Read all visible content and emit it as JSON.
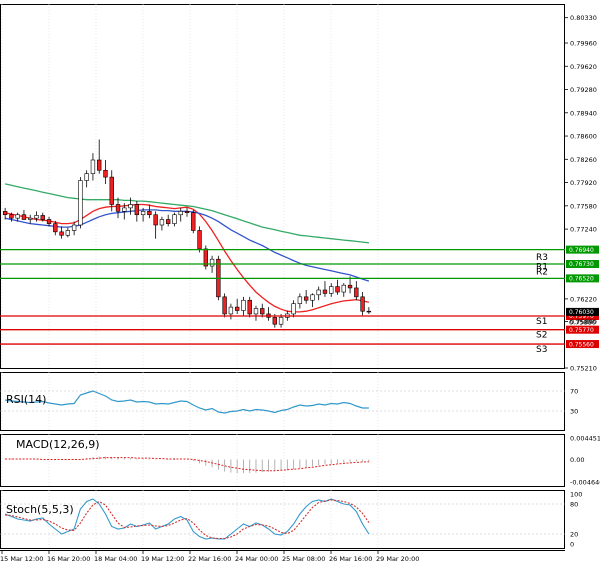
{
  "chart_data": [
    {
      "type": "candlestick",
      "title": "",
      "ylim": [
        0.7521,
        0.8053
      ],
      "y_ticks": [
        "0.80330",
        "0.79960",
        "0.79620",
        "0.79280",
        "0.78940",
        "0.78600",
        "0.78260",
        "0.77920",
        "0.77580",
        "0.77240",
        "0.76220",
        "0.75890",
        "0.75210"
      ],
      "x_ticks": [
        "15 Mar 12:00",
        "16 Mar 20:00",
        "18 Mar 04:00",
        "19 Mar 12:00",
        "22 Mar 16:00",
        "24 Mar 00:00",
        "25 Mar 08:00",
        "26 Mar 16:00",
        "29 Mar 20:00"
      ],
      "candles": [
        [
          0.775,
          0.7755,
          0.7738,
          0.7745
        ],
        [
          0.7745,
          0.7748,
          0.7735,
          0.774
        ],
        [
          0.774,
          0.7748,
          0.7735,
          0.7745
        ],
        [
          0.7745,
          0.7752,
          0.774,
          0.7738
        ],
        [
          0.7738,
          0.7745,
          0.7732,
          0.774
        ],
        [
          0.774,
          0.775,
          0.7735,
          0.7744
        ],
        [
          0.7744,
          0.7748,
          0.7735,
          0.7738
        ],
        [
          0.7738,
          0.7742,
          0.7728,
          0.7732
        ],
        [
          0.7732,
          0.7736,
          0.7715,
          0.772
        ],
        [
          0.772,
          0.7728,
          0.771,
          0.7715
        ],
        [
          0.7715,
          0.7726,
          0.7712,
          0.7722
        ],
        [
          0.7722,
          0.7735,
          0.7715,
          0.773
        ],
        [
          0.773,
          0.78,
          0.7725,
          0.7795
        ],
        [
          0.7795,
          0.781,
          0.7785,
          0.7805
        ],
        [
          0.7805,
          0.7835,
          0.7795,
          0.7825
        ],
        [
          0.7825,
          0.7855,
          0.7805,
          0.781
        ],
        [
          0.781,
          0.7825,
          0.779,
          0.78
        ],
        [
          0.78,
          0.781,
          0.775,
          0.776
        ],
        [
          0.776,
          0.777,
          0.774,
          0.775
        ],
        [
          0.775,
          0.7762,
          0.7738,
          0.7755
        ],
        [
          0.7755,
          0.777,
          0.7745,
          0.776
        ],
        [
          0.776,
          0.7765,
          0.7735,
          0.7745
        ],
        [
          0.7745,
          0.7755,
          0.7735,
          0.775
        ],
        [
          0.775,
          0.776,
          0.774,
          0.7745
        ],
        [
          0.7745,
          0.775,
          0.771,
          0.773
        ],
        [
          0.773,
          0.7742,
          0.7722,
          0.7738
        ],
        [
          0.7738,
          0.7745,
          0.7728,
          0.7732
        ],
        [
          0.7732,
          0.7748,
          0.7728,
          0.7745
        ],
        [
          0.7745,
          0.7755,
          0.7735,
          0.775
        ],
        [
          0.775,
          0.7755,
          0.7742,
          0.7748
        ],
        [
          0.7748,
          0.7752,
          0.7718,
          0.7722
        ],
        [
          0.7722,
          0.7728,
          0.769,
          0.7695
        ],
        [
          0.7695,
          0.77,
          0.7665,
          0.767
        ],
        [
          0.767,
          0.7685,
          0.766,
          0.768
        ],
        [
          0.768,
          0.7685,
          0.762,
          0.7625
        ],
        [
          0.7625,
          0.763,
          0.7595,
          0.76
        ],
        [
          0.76,
          0.7615,
          0.7592,
          0.761
        ],
        [
          0.761,
          0.7622,
          0.76,
          0.7605
        ],
        [
          0.7605,
          0.7625,
          0.7598,
          0.762
        ],
        [
          0.762,
          0.7625,
          0.7595,
          0.76
        ],
        [
          0.76,
          0.7612,
          0.759,
          0.7608
        ],
        [
          0.7608,
          0.7615,
          0.7595,
          0.76
        ],
        [
          0.76,
          0.761,
          0.759,
          0.7595
        ],
        [
          0.7595,
          0.76,
          0.758,
          0.7585
        ],
        [
          0.7585,
          0.76,
          0.758,
          0.7595
        ],
        [
          0.7595,
          0.7605,
          0.759,
          0.76
        ],
        [
          0.76,
          0.762,
          0.7595,
          0.7615
        ],
        [
          0.7615,
          0.763,
          0.7608,
          0.7625
        ],
        [
          0.7625,
          0.7635,
          0.7615,
          0.762
        ],
        [
          0.762,
          0.763,
          0.761,
          0.7628
        ],
        [
          0.7628,
          0.764,
          0.762,
          0.7635
        ],
        [
          0.7635,
          0.7648,
          0.7625,
          0.763
        ],
        [
          0.763,
          0.7645,
          0.7625,
          0.764
        ],
        [
          0.764,
          0.765,
          0.7628,
          0.7632
        ],
        [
          0.7632,
          0.7645,
          0.7625,
          0.7642
        ],
        [
          0.7642,
          0.7655,
          0.763,
          0.7638
        ],
        [
          0.7638,
          0.7648,
          0.762,
          0.7625
        ],
        [
          0.7625,
          0.7632,
          0.7598,
          0.7604
        ],
        [
          0.7604,
          0.761,
          0.76,
          0.7603
        ]
      ],
      "moving_averages": [
        {
          "color": "#ee2222",
          "values": [
            0.7748,
            0.7746,
            0.7744,
            0.7742,
            0.774,
            0.7738,
            0.7737,
            0.7736,
            0.7734,
            0.7732,
            0.7732,
            0.7733,
            0.7738,
            0.7744,
            0.775,
            0.7754,
            0.7756,
            0.7757,
            0.7757,
            0.7758,
            0.7759,
            0.776,
            0.776,
            0.7759,
            0.7757,
            0.7756,
            0.7755,
            0.7754,
            0.7755,
            0.7756,
            0.7753,
            0.7746,
            0.7735,
            0.7722,
            0.7707,
            0.7692,
            0.7678,
            0.7665,
            0.7653,
            0.7642,
            0.7632,
            0.7624,
            0.7617,
            0.7611,
            0.7607,
            0.7604,
            0.7603,
            0.7603,
            0.7604,
            0.7606,
            0.7609,
            0.7612,
            0.7615,
            0.7617,
            0.7619,
            0.762,
            0.7621,
            0.7619,
            0.7617
          ]
        },
        {
          "color": "#3355cc",
          "values": [
            0.774,
            0.7738,
            0.7736,
            0.7734,
            0.7732,
            0.7731,
            0.773,
            0.7729,
            0.7728,
            0.7727,
            0.7727,
            0.7728,
            0.773,
            0.7734,
            0.7738,
            0.7742,
            0.7745,
            0.7747,
            0.7748,
            0.7749,
            0.775,
            0.7751,
            0.7752,
            0.7752,
            0.7752,
            0.7751,
            0.7751,
            0.775,
            0.775,
            0.775,
            0.7749,
            0.7747,
            0.7744,
            0.774,
            0.7735,
            0.7729,
            0.7723,
            0.7718,
            0.7713,
            0.7708,
            0.7704,
            0.77,
            0.7695,
            0.769,
            0.7686,
            0.7682,
            0.7678,
            0.7674,
            0.7671,
            0.7669,
            0.7667,
            0.7665,
            0.7663,
            0.7661,
            0.7659,
            0.7657,
            0.7654,
            0.7651,
            0.7648
          ]
        },
        {
          "color": "#33aa66",
          "values": [
            0.779,
            0.7788,
            0.7786,
            0.7784,
            0.7782,
            0.778,
            0.7778,
            0.7776,
            0.7774,
            0.7772,
            0.777,
            0.7769,
            0.7768,
            0.7767,
            0.7767,
            0.7767,
            0.7767,
            0.7767,
            0.7767,
            0.7766,
            0.7766,
            0.7765,
            0.7765,
            0.7764,
            0.7763,
            0.7762,
            0.7761,
            0.776,
            0.7759,
            0.7758,
            0.7757,
            0.7755,
            0.7753,
            0.7751,
            0.7748,
            0.7745,
            0.7742,
            0.7739,
            0.7736,
            0.7733,
            0.773,
            0.7727,
            0.7725,
            0.7723,
            0.7721,
            0.7719,
            0.7717,
            0.7715,
            0.7714,
            0.7713,
            0.7712,
            0.7711,
            0.771,
            0.7709,
            0.7708,
            0.7707,
            0.7706,
            0.7705,
            0.7704
          ]
        }
      ],
      "levels": [
        {
          "name": "R3",
          "value": 0.7673,
          "label": "0.76730",
          "color": "#009900"
        },
        {
          "name": "R2",
          "value": 0.7652,
          "label": "0.76520",
          "color": "#009900"
        },
        {
          "name": "R1",
          "value": 0.7694,
          "label": "0.76940",
          "color": "#009900",
          "unlabeled": true
        },
        {
          "name": "S1",
          "value": 0.7597,
          "label": "0.75970",
          "color": "#dd0000"
        },
        {
          "name": "S2",
          "value": 0.7577,
          "label": "0.75770",
          "color": "#dd0000"
        },
        {
          "name": "S3",
          "value": 0.7556,
          "label": "0.75560",
          "color": "#dd0000"
        }
      ],
      "current_price": "0.76030",
      "extra_box": "0.75880"
    },
    {
      "type": "line",
      "title": "RSI(14)",
      "ylim": [
        0,
        100
      ],
      "y_ticks": [
        "70",
        "30"
      ],
      "values": [
        52,
        50,
        49,
        48,
        47,
        48,
        49,
        46,
        44,
        42,
        44,
        45,
        62,
        66,
        70,
        65,
        60,
        52,
        49,
        50,
        52,
        48,
        49,
        48,
        44,
        45,
        44,
        47,
        50,
        49,
        42,
        36,
        32,
        35,
        28,
        26,
        29,
        30,
        33,
        30,
        33,
        32,
        30,
        27,
        31,
        33,
        38,
        42,
        40,
        41,
        44,
        42,
        45,
        44,
        47,
        45,
        40,
        36,
        36
      ]
    },
    {
      "type": "histogram",
      "title": "MACD(12,26,9)",
      "ylim": [
        -0.004646,
        0.004451
      ],
      "y_ticks": [
        "0.004451",
        "0.00",
        "-0.004646"
      ],
      "histogram": [
        0.0002,
        0.0002,
        0.0001,
        0.0001,
        0.0001,
        0.0001,
        0.0,
        0.0,
        -0.0001,
        -0.0001,
        -0.0001,
        -0.0001,
        0.0001,
        0.0003,
        0.0005,
        0.0006,
        0.0006,
        0.0005,
        0.0004,
        0.0003,
        0.0003,
        0.0002,
        0.0002,
        0.0001,
        0.0,
        0.0,
        -0.0001,
        -0.0001,
        0.0,
        0.0,
        -0.0003,
        -0.0008,
        -0.0013,
        -0.0016,
        -0.0021,
        -0.0025,
        -0.0027,
        -0.0028,
        -0.0028,
        -0.0028,
        -0.0027,
        -0.0026,
        -0.0025,
        -0.0024,
        -0.0023,
        -0.0022,
        -0.002,
        -0.0018,
        -0.0016,
        -0.0014,
        -0.0012,
        -0.001,
        -0.0009,
        -0.0007,
        -0.0006,
        -0.0005,
        -0.0004,
        -0.0004,
        -0.0004
      ],
      "signal": [
        0.0001,
        0.0001,
        0.0001,
        0.0001,
        0.0001,
        0.0001,
        0.0,
        0.0,
        0.0,
        0.0,
        0.0,
        0.0,
        0.0,
        0.0001,
        0.0002,
        0.0003,
        0.0004,
        0.0004,
        0.0004,
        0.0004,
        0.0004,
        0.0003,
        0.0003,
        0.0003,
        0.0002,
        0.0002,
        0.0001,
        0.0001,
        0.0001,
        0.0001,
        0.0,
        -0.0002,
        -0.0004,
        -0.0007,
        -0.001,
        -0.0013,
        -0.0016,
        -0.0018,
        -0.002,
        -0.0021,
        -0.0022,
        -0.0023,
        -0.0023,
        -0.0023,
        -0.0022,
        -0.0021,
        -0.002,
        -0.0019,
        -0.0017,
        -0.0016,
        -0.0014,
        -0.0012,
        -0.0011,
        -0.0009,
        -0.0008,
        -0.0007,
        -0.0006,
        -0.0005,
        -0.0005
      ]
    },
    {
      "type": "line",
      "title": "Stoch(5,5,3)",
      "ylim": [
        0,
        100
      ],
      "y_ticks": [
        "100",
        "80",
        "20",
        "0"
      ],
      "series": [
        {
          "color": "#3399cc",
          "values": [
            60,
            55,
            50,
            48,
            46,
            50,
            52,
            40,
            30,
            20,
            25,
            30,
            70,
            85,
            90,
            80,
            60,
            35,
            30,
            32,
            40,
            35,
            38,
            42,
            30,
            35,
            40,
            50,
            55,
            48,
            25,
            15,
            10,
            12,
            10,
            10,
            20,
            30,
            40,
            35,
            42,
            38,
            30,
            20,
            18,
            25,
            40,
            60,
            75,
            85,
            88,
            85,
            90,
            85,
            80,
            78,
            65,
            40,
            20
          ]
        },
        {
          "color": "#cc3333",
          "values": [
            58,
            57,
            54,
            51,
            48,
            48,
            49,
            46,
            40,
            32,
            28,
            27,
            42,
            62,
            78,
            85,
            78,
            60,
            42,
            33,
            34,
            36,
            37,
            38,
            36,
            35,
            37,
            42,
            48,
            51,
            42,
            28,
            17,
            12,
            11,
            11,
            14,
            20,
            30,
            35,
            39,
            38,
            36,
            30,
            23,
            21,
            27,
            42,
            58,
            73,
            83,
            86,
            88,
            87,
            85,
            81,
            74,
            61,
            43
          ]
        }
      ]
    }
  ],
  "colors": {
    "background": "#ffffff",
    "bull_candle": "#ffffff",
    "bear_candle": "#ee2222",
    "grid": "#d8d8d8"
  }
}
